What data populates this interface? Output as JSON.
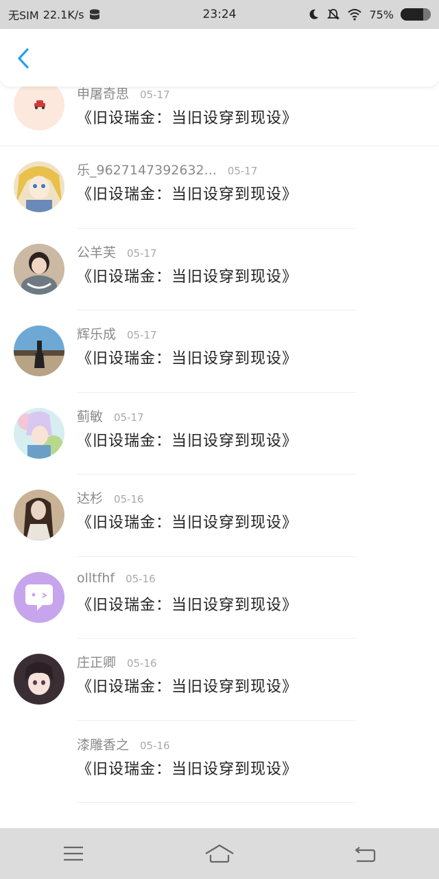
{
  "status_bar": {
    "carrier": "无SIM",
    "net_speed": "22.1K/s",
    "time": "23:24",
    "battery_text": "75%",
    "battery_level": 0.75
  },
  "header": {
    "back_icon": "chevron-left-icon",
    "accent": "#2a9df4"
  },
  "list": {
    "items": [
      {
        "name": "申屠奇思",
        "date": "05-17",
        "title": "《旧设瑞金：当旧设穿到现设》",
        "avatar": "car"
      },
      {
        "name": "乐_9627147392632...",
        "date": "05-17",
        "title": "《旧设瑞金：当旧设穿到现设》",
        "avatar": "anime-blonde"
      },
      {
        "name": "公羊芙",
        "date": "05-17",
        "title": "《旧设瑞金：当旧设穿到现设》",
        "avatar": "child-photo"
      },
      {
        "name": "辉乐成",
        "date": "05-17",
        "title": "《旧设瑞金：当旧设穿到现设》",
        "avatar": "road-photo"
      },
      {
        "name": "蓟敏",
        "date": "05-17",
        "title": "《旧设瑞金：当旧设穿到现设》",
        "avatar": "anime-colorful"
      },
      {
        "name": "达杉",
        "date": "05-16",
        "title": "《旧设瑞金：当旧设穿到现设》",
        "avatar": "woman-photo"
      },
      {
        "name": "olltfhf",
        "date": "05-16",
        "title": "《旧设瑞金：当旧设穿到现设》",
        "avatar": "chat-bubble"
      },
      {
        "name": "庄正卿",
        "date": "05-16",
        "title": "《旧设瑞金：当旧设穿到现设》",
        "avatar": "anime-girl"
      },
      {
        "name": "漆雕香之",
        "date": "05-16",
        "title": "《旧设瑞金：当旧设穿到现设》",
        "avatar": "none"
      }
    ]
  },
  "nav_bar": {
    "menu_icon": "menu-icon",
    "home_icon": "home-icon",
    "back_icon": "back-icon"
  }
}
